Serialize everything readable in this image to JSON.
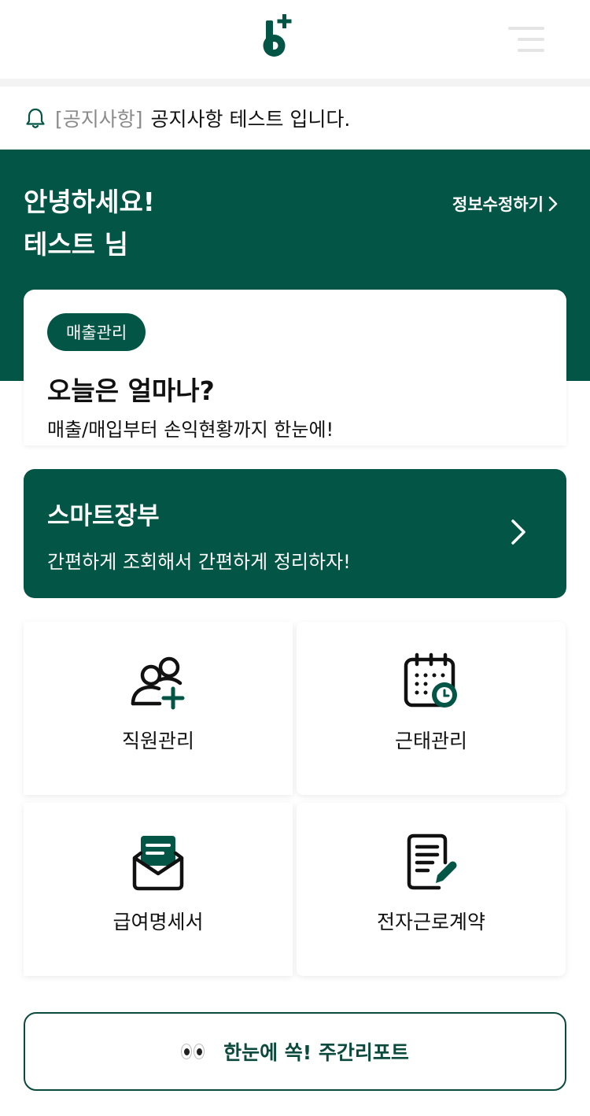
{
  "notice": {
    "tag": "[공지사항]",
    "text": "공지사항 테스트 입니다."
  },
  "greeting": {
    "line1": "안녕하세요!",
    "line2": "테스트 님"
  },
  "profile": {
    "edit_label": "정보수정하기"
  },
  "sales_card": {
    "badge": "매출관리",
    "title": "오늘은 얼마나?",
    "subtitle": "매출/매입부터 손익현황까지 한눈에!"
  },
  "smart_ledger": {
    "title": "스마트장부",
    "subtitle": "간편하게 조회해서 간편하게 정리하자!"
  },
  "menu_tiles": [
    {
      "label": "직원관리",
      "icon": "add-user-icon"
    },
    {
      "label": "근태관리",
      "icon": "calendar-clock-icon"
    },
    {
      "label": "급여명세서",
      "icon": "envelope-letter-icon"
    },
    {
      "label": "전자근로계약",
      "icon": "document-pen-icon"
    }
  ],
  "weekly_report": {
    "label": "한눈에 쏙! 주간리포트"
  },
  "colors": {
    "brand": "#035545",
    "brand_dark": "#0b4a3c",
    "divider": "#f3f3f3"
  }
}
